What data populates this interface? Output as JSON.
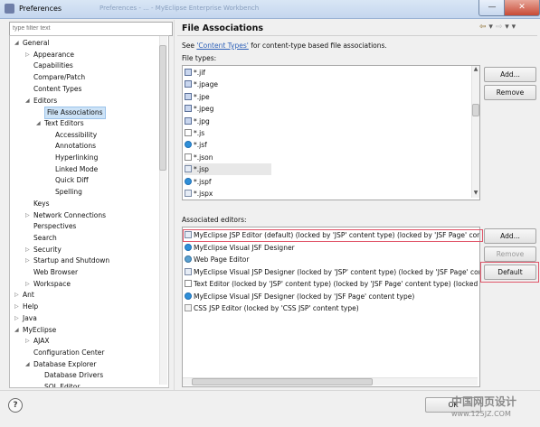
{
  "window": {
    "title": "Preferences",
    "ghost_title": "Preferences - ... - MyEclipse Enterprise Workbench"
  },
  "filter": {
    "placeholder": "type filter text"
  },
  "tree": [
    {
      "label": "General",
      "depth": 0,
      "twisty": "open"
    },
    {
      "label": "Appearance",
      "depth": 1,
      "twisty": "closed"
    },
    {
      "label": "Capabilities",
      "depth": 1,
      "twisty": "none"
    },
    {
      "label": "Compare/Patch",
      "depth": 1,
      "twisty": "none"
    },
    {
      "label": "Content Types",
      "depth": 1,
      "twisty": "none"
    },
    {
      "label": "Editors",
      "depth": 1,
      "twisty": "open"
    },
    {
      "label": "File Associations",
      "depth": 2,
      "twisty": "none",
      "selected": true
    },
    {
      "label": "Text Editors",
      "depth": 2,
      "twisty": "open"
    },
    {
      "label": "Accessibility",
      "depth": 3,
      "twisty": "none"
    },
    {
      "label": "Annotations",
      "depth": 3,
      "twisty": "none"
    },
    {
      "label": "Hyperlinking",
      "depth": 3,
      "twisty": "none"
    },
    {
      "label": "Linked Mode",
      "depth": 3,
      "twisty": "none"
    },
    {
      "label": "Quick Diff",
      "depth": 3,
      "twisty": "none"
    },
    {
      "label": "Spelling",
      "depth": 3,
      "twisty": "none"
    },
    {
      "label": "Keys",
      "depth": 1,
      "twisty": "none"
    },
    {
      "label": "Network Connections",
      "depth": 1,
      "twisty": "closed"
    },
    {
      "label": "Perspectives",
      "depth": 1,
      "twisty": "none"
    },
    {
      "label": "Search",
      "depth": 1,
      "twisty": "none"
    },
    {
      "label": "Security",
      "depth": 1,
      "twisty": "closed"
    },
    {
      "label": "Startup and Shutdown",
      "depth": 1,
      "twisty": "closed"
    },
    {
      "label": "Web Browser",
      "depth": 1,
      "twisty": "none"
    },
    {
      "label": "Workspace",
      "depth": 1,
      "twisty": "closed"
    },
    {
      "label": "Ant",
      "depth": 0,
      "twisty": "closed"
    },
    {
      "label": "Help",
      "depth": 0,
      "twisty": "closed"
    },
    {
      "label": "Java",
      "depth": 0,
      "twisty": "closed"
    },
    {
      "label": "MyEclipse",
      "depth": 0,
      "twisty": "open"
    },
    {
      "label": "AJAX",
      "depth": 1,
      "twisty": "closed"
    },
    {
      "label": "Configuration Center",
      "depth": 1,
      "twisty": "none"
    },
    {
      "label": "Database Explorer",
      "depth": 1,
      "twisty": "open"
    },
    {
      "label": "Database Drivers",
      "depth": 2,
      "twisty": "none"
    },
    {
      "label": "SQL Editor",
      "depth": 2,
      "twisty": "none"
    }
  ],
  "page": {
    "heading": "File Associations",
    "note_prefix": "See ",
    "note_link": "'Content Types'",
    "note_suffix": " for content-type based file associations.",
    "file_types_label": "File types:",
    "associated_label": "Associated editors:"
  },
  "file_types": [
    {
      "label": "*.jif",
      "icon": "file-image"
    },
    {
      "label": "*.jpage",
      "icon": "java-page"
    },
    {
      "label": "*.jpe",
      "icon": "file-image"
    },
    {
      "label": "*.jpeg",
      "icon": "file-image"
    },
    {
      "label": "*.jpg",
      "icon": "file-image"
    },
    {
      "label": "*.js",
      "icon": "js-file"
    },
    {
      "label": "*.jsf",
      "icon": "jsf-globe"
    },
    {
      "label": "*.json",
      "icon": "json-file"
    },
    {
      "label": "*.jsp",
      "icon": "jsp-file",
      "selected": true
    },
    {
      "label": "*.jspf",
      "icon": "jsf-globe"
    },
    {
      "label": "*.jspx",
      "icon": "jsp-file"
    }
  ],
  "editors": [
    {
      "label": "MyEclipse JSP Editor (default) (locked by 'JSP' content type) (locked by 'JSF Page' content type)",
      "icon": "jsp-editor",
      "highlighted": true
    },
    {
      "label": "MyEclipse Visual JSF Designer",
      "icon": "jsf-globe"
    },
    {
      "label": "Web Page Editor",
      "icon": "web-page"
    },
    {
      "label": "MyEclipse Visual JSP Designer (locked by 'JSP' content type) (locked by 'JSF Page' content type)",
      "icon": "jsp-editor"
    },
    {
      "label": "Text Editor (locked by 'JSP' content type) (locked by 'JSF Page' content type) (locked by 'JSP Fragment' content type)",
      "icon": "text-file"
    },
    {
      "label": "MyEclipse Visual JSF Designer (locked by 'JSF Page' content type)",
      "icon": "jsf-globe"
    },
    {
      "label": "CSS JSP Editor (locked by 'CSS JSP' content type)",
      "icon": "css-file"
    }
  ],
  "buttons": {
    "add_types": "Add...",
    "remove_types": "Remove",
    "add_editor": "Add...",
    "remove_editor": "Remove",
    "default_editor": "Default",
    "ok": "OK",
    "help": "?"
  },
  "watermark": {
    "line1": "中国网页设计",
    "line2": "www.125JZ.COM"
  },
  "colors": {
    "selection": "#cde3f7",
    "highlight_box": "#e0566a",
    "link": "#2b5fb8"
  }
}
